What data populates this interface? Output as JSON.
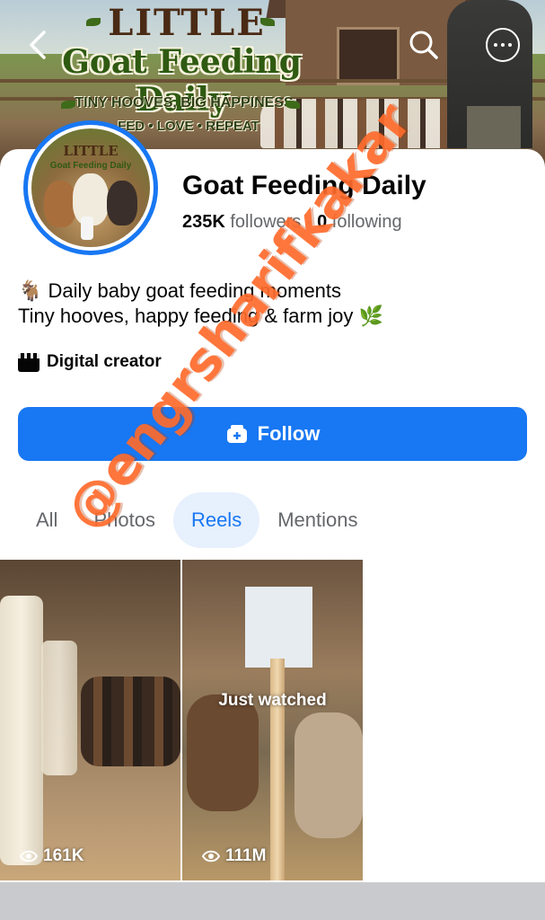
{
  "cover": {
    "title_line1": "LITTLE",
    "title_line2": "Goat Feeding Daily",
    "tagline": "TINY HOOVES, BIG HAPPINESS",
    "tagline2": "FED • LOVE • REPEAT"
  },
  "topbar": {
    "back_icon": "chevron-left-icon",
    "search_icon": "search-icon",
    "more_icon": "more-horizontal-icon"
  },
  "avatar": {
    "title": "LITTLE",
    "subtitle": "Goat Feeding Daily"
  },
  "profile": {
    "name": "Goat Feeding Daily",
    "followers_count": "235K",
    "followers_label": "followers",
    "separator": "·",
    "following_count": "0",
    "following_label": "following",
    "bio_line1": "🐐 Daily baby goat feeding moments",
    "bio_line2": "Tiny hooves, happy feeding & farm joy 🌿",
    "category": "Digital creator"
  },
  "follow_button": {
    "label": "Follow"
  },
  "tabs": [
    {
      "label": "All",
      "active": false
    },
    {
      "label": "Photos",
      "active": false
    },
    {
      "label": "Reels",
      "active": true
    },
    {
      "label": "Mentions",
      "active": false
    }
  ],
  "reels": [
    {
      "views": "161K",
      "overlay": ""
    },
    {
      "views": "111M",
      "overlay": "Just watched"
    }
  ],
  "watermark": "@engrsharifkakar",
  "colors": {
    "accent": "#1877f2",
    "watermark": "#ff6b2c",
    "active_tab_bg": "#e7f0fd"
  }
}
